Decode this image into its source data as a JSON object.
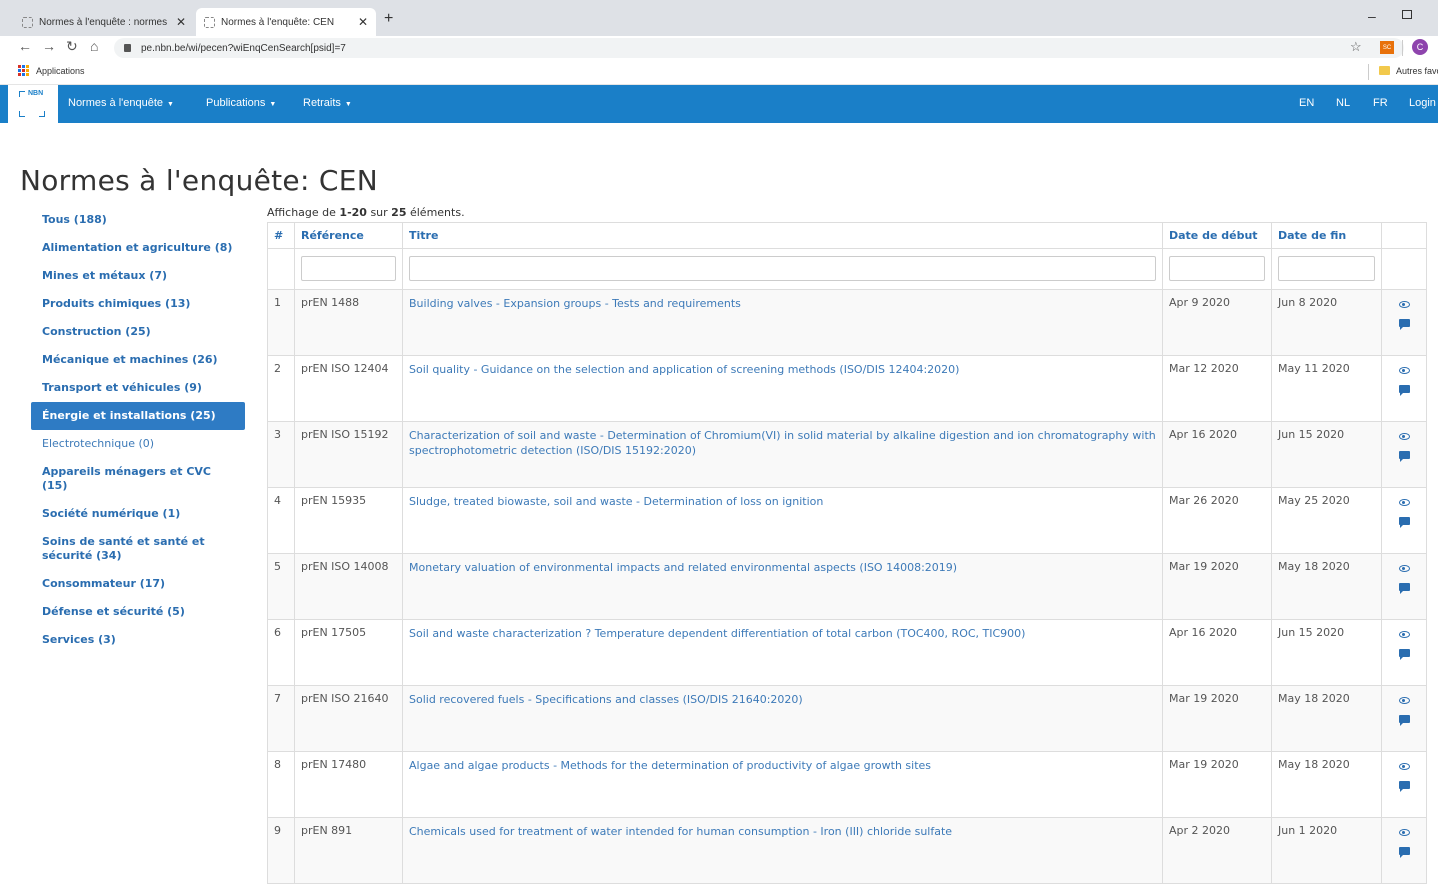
{
  "browser": {
    "tabs": [
      {
        "label": "Normes à l'enquête : normes en"
      },
      {
        "label": "Normes à l'enquête: CEN"
      }
    ],
    "new_tab_label": "+",
    "url": "pe.nbn.be/wi/pecen?wiEnqCenSearch[psid]=7",
    "profile_initial": "C",
    "extension_label": "SC",
    "bookmarks": {
      "apps_label": "Applications",
      "other_label": "Autres favoris"
    }
  },
  "site": {
    "logo_text": "NBN",
    "nav": [
      {
        "label": "Normes à l'enquête"
      },
      {
        "label": "Publications"
      },
      {
        "label": "Retraits"
      }
    ],
    "languages": [
      "EN",
      "NL",
      "FR"
    ],
    "login_label": "Login"
  },
  "page": {
    "title": "Normes à l'enquête: CEN",
    "summary": {
      "prefix": "Affichage de ",
      "range": "1-20",
      "middle": " sur ",
      "total": "25",
      "suffix": " éléments."
    }
  },
  "sidebar": {
    "items": [
      {
        "label": "Tous (188)"
      },
      {
        "label": "Alimentation et agriculture (8)"
      },
      {
        "label": "Mines et métaux (7)"
      },
      {
        "label": "Produits chimiques (13)"
      },
      {
        "label": "Construction (25)"
      },
      {
        "label": "Mécanique et machines (26)"
      },
      {
        "label": "Transport et véhicules (9)"
      },
      {
        "label": "Énergie et installations (25)"
      },
      {
        "label": "Electrotechnique (0)"
      },
      {
        "label": "Appareils ménagers et CVC (15)"
      },
      {
        "label": "Société numérique (1)"
      },
      {
        "label": "Soins de santé et santé et sécurité (34)"
      },
      {
        "label": "Consommateur (17)"
      },
      {
        "label": "Défense et sécurité (5)"
      },
      {
        "label": "Services (3)"
      }
    ],
    "active_index": 7
  },
  "table": {
    "headers": {
      "num": "#",
      "reference": "Référence",
      "title": "Titre",
      "start": "Date de début",
      "end": "Date de fin"
    },
    "rows": [
      {
        "num": "1",
        "ref": "prEN 1488",
        "title": "Building valves - Expansion groups - Tests and requirements",
        "start": "Apr 9 2020",
        "end": "Jun 8 2020"
      },
      {
        "num": "2",
        "ref": "prEN ISO 12404",
        "title": "Soil quality - Guidance on the selection and application of screening methods (ISO/DIS 12404:2020)",
        "start": "Mar 12 2020",
        "end": "May 11 2020"
      },
      {
        "num": "3",
        "ref": "prEN ISO 15192",
        "title": "Characterization of soil and waste - Determination of Chromium(VI) in solid material by alkaline digestion and ion chromatography with spectrophotometric detection (ISO/DIS 15192:2020)",
        "start": "Apr 16 2020",
        "end": "Jun 15 2020"
      },
      {
        "num": "4",
        "ref": "prEN 15935",
        "title": "Sludge, treated biowaste, soil and waste - Determination of loss on ignition",
        "start": "Mar 26 2020",
        "end": "May 25 2020"
      },
      {
        "num": "5",
        "ref": "prEN ISO 14008",
        "title": "Monetary valuation of environmental impacts and related environmental aspects (ISO 14008:2019)",
        "start": "Mar 19 2020",
        "end": "May 18 2020"
      },
      {
        "num": "6",
        "ref": "prEN 17505",
        "title": "Soil and waste characterization ? Temperature dependent differentiation of total carbon (TOC400, ROC, TIC900)",
        "start": "Apr 16 2020",
        "end": "Jun 15 2020"
      },
      {
        "num": "7",
        "ref": "prEN ISO 21640",
        "title": "Solid recovered fuels - Specifications and classes (ISO/DIS 21640:2020)",
        "start": "Mar 19 2020",
        "end": "May 18 2020"
      },
      {
        "num": "8",
        "ref": "prEN 17480",
        "title": "Algae and algae products - Methods for the determination of productivity of algae growth sites",
        "start": "Mar 19 2020",
        "end": "May 18 2020"
      },
      {
        "num": "9",
        "ref": "prEN 891",
        "title": "Chemicals used for treatment of water intended for human consumption - Iron (III) chloride sulfate",
        "start": "Apr 2 2020",
        "end": "Jun 1 2020"
      }
    ]
  },
  "colors": {
    "navbar": "#1a7fc8",
    "link": "#2a6db0",
    "active": "#2e7bc4"
  }
}
